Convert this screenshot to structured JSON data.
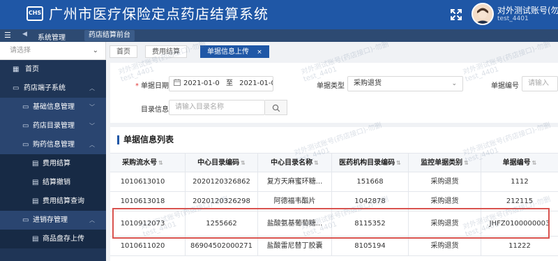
{
  "header": {
    "logo_text": "CHS",
    "title": "广州市医疗保险定点药店结算系统",
    "user_name": "对外测试账号(勿",
    "user_id": "test_4401"
  },
  "subheader": {
    "system": "系统管理",
    "module": "药店结算前台"
  },
  "sidebar": {
    "select_placeholder": "请选择",
    "items": [
      {
        "label": "首页"
      },
      {
        "label": "药店端子系统"
      },
      {
        "label": "基础信息管理"
      },
      {
        "label": "药店目录管理"
      },
      {
        "label": "购药信息管理"
      },
      {
        "label": "费用结算"
      },
      {
        "label": "结算撤销"
      },
      {
        "label": "费用结算查询"
      },
      {
        "label": "进销存管理"
      },
      {
        "label": "商品盘存上传"
      }
    ]
  },
  "tabs": [
    {
      "label": "首页"
    },
    {
      "label": "费用结算"
    },
    {
      "label": "单据信息上传",
      "close": "×"
    }
  ],
  "filters": {
    "date_label": "单据日期",
    "date_start": "2021-01-0",
    "date_sep": "至",
    "date_end": "2021-01-0",
    "type_label": "单据类型",
    "type_value": "采购退货",
    "number_label": "单据编号",
    "number_placeholder": "请输入",
    "catalog_label": "目录信息",
    "catalog_placeholder": "请输入目录名称"
  },
  "table": {
    "title": "单据信息列表",
    "columns": [
      "采购流水号",
      "中心目录编码",
      "中心目录名称",
      "医药机构目录编码",
      "监控单据类别",
      "单据编号"
    ],
    "rows": [
      [
        "1010613010",
        "2020120326862",
        "复方天麻蜜环糖...",
        "151668",
        "采购退货",
        "1112"
      ],
      [
        "1010613018",
        "2020120326298",
        "阿德福韦酯片",
        "1042878",
        "采购退货",
        "212115"
      ],
      [
        "1010912073",
        "1255662",
        "盐酸氨基葡萄糖...",
        "8115352",
        "采购退货",
        "JHFZ0100000003"
      ],
      [
        "1010611020",
        "86904502000271",
        "盐酸雷尼替丁胶囊",
        "8105194",
        "采购退货",
        "11222"
      ]
    ]
  },
  "watermark": {
    "line1": "对外测试账号(药店接口)-勿删",
    "line2": "test_4401"
  },
  "colors": {
    "header_bg": "#1f57a6",
    "sidebar_bg": "#1f3556",
    "accent": "#1f57a6",
    "required": "#e23a3a",
    "highlight": "#d9534f"
  }
}
